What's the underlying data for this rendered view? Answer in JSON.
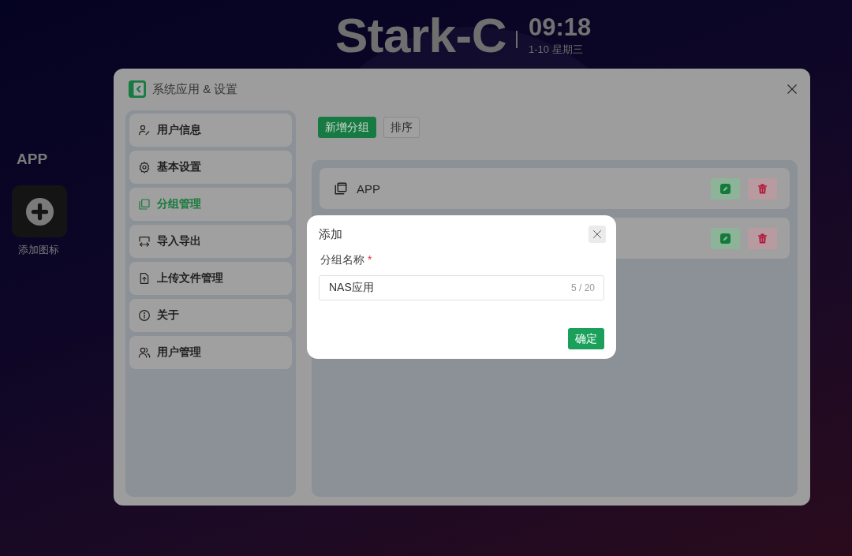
{
  "header": {
    "brand": "Stark-C",
    "time": "09:18",
    "date": "1-10 星期三"
  },
  "desktop": {
    "group_title": "APP",
    "add_tile_label": "添加图标"
  },
  "settings_window": {
    "title": "系统应用 & 设置",
    "menu": [
      {
        "label": "用户信息",
        "kind": "profile",
        "selected": false
      },
      {
        "label": "基本设置",
        "kind": "settings",
        "selected": false
      },
      {
        "label": "分组管理",
        "kind": "groups",
        "selected": true
      },
      {
        "label": "导入导出",
        "kind": "transfer",
        "selected": false
      },
      {
        "label": "上传文件管理",
        "kind": "upload",
        "selected": false
      },
      {
        "label": "关于",
        "kind": "about",
        "selected": false
      },
      {
        "label": "用户管理",
        "kind": "users",
        "selected": false
      }
    ],
    "toolbar": [
      {
        "label": "新增分组",
        "kind": "primary"
      },
      {
        "label": "排序",
        "kind": "default"
      }
    ],
    "groups": [
      {
        "kind": "labeled",
        "name": "APP"
      },
      {
        "kind": "actions"
      }
    ]
  },
  "dialog": {
    "title": "添加",
    "field_label": "分组名称",
    "required_mark": "*",
    "value": "NAS应用",
    "counter": "5 / 20",
    "confirm": "确定"
  }
}
